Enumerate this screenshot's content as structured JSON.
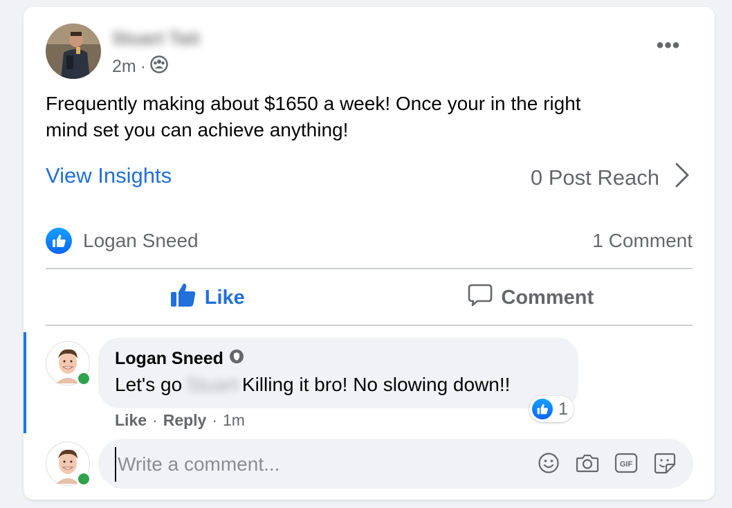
{
  "post": {
    "author": "Stuart Tait",
    "time": "2m",
    "separator": "·",
    "text_line1": "Frequently making about $1650 a week!  Once your in the right",
    "text_line2": "mind set you can achieve anything!",
    "privacy_icon": "group-audience-icon"
  },
  "insights": {
    "view_label": "View Insights",
    "reach_label": "0 Post Reach"
  },
  "reactions": {
    "reactor": "Logan Sneed",
    "comment_count": "1 Comment"
  },
  "actions": {
    "like_label": "Like",
    "comment_label": "Comment"
  },
  "comment": {
    "author": "Logan Sneed",
    "text_start": "Let's go",
    "mention": "Stuart",
    "text_end": "Killing it bro! No slowing down!!",
    "reaction_count": "1",
    "like_label": "Like",
    "reply_label": "Reply",
    "dot": "·",
    "time": "1m"
  },
  "composer": {
    "placeholder": "Write a comment..."
  },
  "colors": {
    "accent": "#216fdb",
    "online": "#31a24c",
    "muted": "#65676b"
  }
}
